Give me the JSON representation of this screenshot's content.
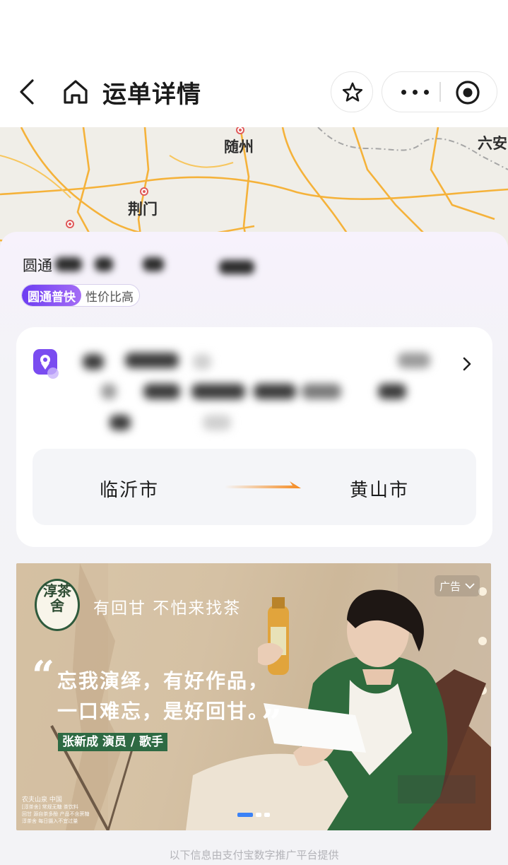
{
  "nav": {
    "title": "运单详情",
    "back_icon": "chevron-left-icon",
    "home_icon": "home-icon",
    "favorite_icon": "star-icon",
    "more_icon": "more-dots-icon",
    "close_icon": "target-close-icon"
  },
  "map": {
    "labels": [
      "随州",
      "荆门",
      "六安"
    ]
  },
  "shipment": {
    "carrier_prefix": "圆通",
    "service_tag": "圆通普快",
    "service_desc": "性价比高"
  },
  "route": {
    "from_city": "临沂市",
    "to_city": "黄山市",
    "arrow_color": "#f58a1f",
    "pin_color": "#7a4cf0"
  },
  "ad": {
    "brand_logo": "淳茶舍",
    "slogan": "有回甘 不怕来找茶",
    "badge": "广告",
    "quote_line1": "忘我演绎，有好作品，",
    "quote_line2": "一口难忘，是好回甘。",
    "endorser": "张新成 演员 / 歌手",
    "fine_print_1": "农夫山泉 中国",
    "fine_print_2": "[淳茶舍] 常规无糖 茶饮料",
    "fine_print_3": "回甘 源自茶多酚 产品不含蔗糖",
    "fine_print_4": "淳茶舍 每日摄入不宜过量",
    "slide_index": 1,
    "slide_count": 3
  },
  "footer": {
    "text": "以下信息由支付宝数字推广平台提供"
  }
}
